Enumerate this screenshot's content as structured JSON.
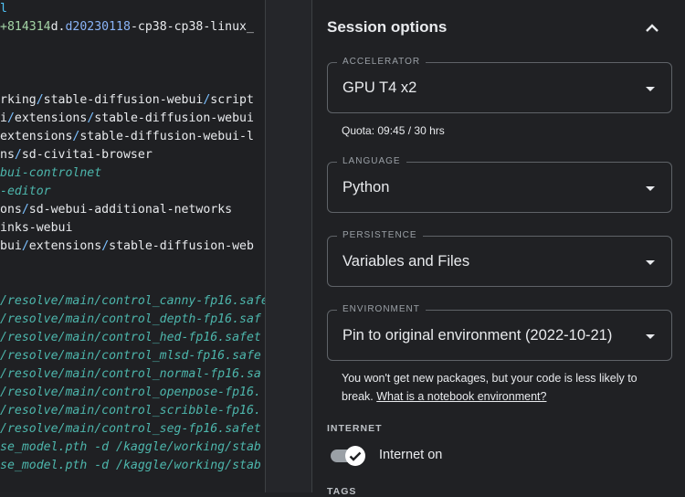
{
  "code_lines": [
    {
      "parts": [
        {
          "t": "l",
          "c": "c-cyan"
        }
      ]
    },
    {
      "parts": [
        {
          "t": "+814314",
          "c": "c-green"
        },
        {
          "t": "d.",
          "c": "c-white"
        },
        {
          "t": "d20230118",
          "c": "c-blue"
        },
        {
          "t": "-cp38-cp38-linux_",
          "c": "c-white"
        }
      ]
    },
    {
      "parts": []
    },
    {
      "parts": []
    },
    {
      "parts": []
    },
    {
      "parts": [
        {
          "t": "rking",
          "c": "c-white"
        },
        {
          "t": "/",
          "c": "c-slash"
        },
        {
          "t": "stable-diffusion-webui",
          "c": "c-white"
        },
        {
          "t": "/",
          "c": "c-slash"
        },
        {
          "t": "script",
          "c": "c-white"
        }
      ]
    },
    {
      "parts": [
        {
          "t": "i",
          "c": "c-white"
        },
        {
          "t": "/",
          "c": "c-slash"
        },
        {
          "t": "extensions",
          "c": "c-white"
        },
        {
          "t": "/",
          "c": "c-slash"
        },
        {
          "t": "stable-diffusion-webui",
          "c": "c-white"
        }
      ]
    },
    {
      "parts": [
        {
          "t": "extensions",
          "c": "c-white"
        },
        {
          "t": "/",
          "c": "c-slash"
        },
        {
          "t": "stable-diffusion-webui-l",
          "c": "c-white"
        }
      ]
    },
    {
      "parts": [
        {
          "t": "ns",
          "c": "c-white"
        },
        {
          "t": "/",
          "c": "c-slash"
        },
        {
          "t": "sd-civitai-browser",
          "c": "c-white"
        }
      ]
    },
    {
      "parts": [
        {
          "t": "bui-controlnet",
          "c": "c-ital"
        }
      ]
    },
    {
      "parts": [
        {
          "t": "-editor",
          "c": "c-ital"
        }
      ]
    },
    {
      "parts": [
        {
          "t": "ons",
          "c": "c-white"
        },
        {
          "t": "/",
          "c": "c-slash"
        },
        {
          "t": "sd-webui-additional-networks",
          "c": "c-white"
        }
      ]
    },
    {
      "parts": [
        {
          "t": "inks-webui",
          "c": "c-white"
        }
      ]
    },
    {
      "parts": [
        {
          "t": "bui",
          "c": "c-white"
        },
        {
          "t": "/",
          "c": "c-slash"
        },
        {
          "t": "extensions",
          "c": "c-white"
        },
        {
          "t": "/",
          "c": "c-slash"
        },
        {
          "t": "stable-diffusion-web",
          "c": "c-white"
        }
      ]
    },
    {
      "parts": []
    },
    {
      "parts": []
    },
    {
      "parts": [
        {
          "t": "/resolve/main/control_canny-fp16.safe",
          "c": "c-ital"
        }
      ]
    },
    {
      "parts": [
        {
          "t": "/resolve/main/control_depth-fp16.saf",
          "c": "c-ital"
        }
      ]
    },
    {
      "parts": [
        {
          "t": "/resolve/main/control_hed-fp16.safet",
          "c": "c-ital"
        }
      ]
    },
    {
      "parts": [
        {
          "t": "/resolve/main/control_mlsd-fp16.safe",
          "c": "c-ital"
        }
      ]
    },
    {
      "parts": [
        {
          "t": "/resolve/main/control_normal-fp16.sa",
          "c": "c-ital"
        }
      ]
    },
    {
      "parts": [
        {
          "t": "/resolve/main/control_openpose-fp16.",
          "c": "c-ital"
        }
      ]
    },
    {
      "parts": [
        {
          "t": "/resolve/main/control_scribble-fp16.",
          "c": "c-ital"
        }
      ]
    },
    {
      "parts": [
        {
          "t": "/resolve/main/control_seg-fp16.safet",
          "c": "c-ital"
        }
      ]
    },
    {
      "parts": [
        {
          "t": "se_model.pth -d /kaggle/working/stab",
          "c": "c-ital"
        }
      ]
    },
    {
      "parts": [
        {
          "t": "se_model.pth -d /kaggle/working/stab",
          "c": "c-ital"
        }
      ]
    }
  ],
  "panel": {
    "title": "Session options",
    "accelerator": {
      "label": "ACCELERATOR",
      "value": "GPU T4 x2",
      "quota": "Quota: 09:45 / 30 hrs"
    },
    "language": {
      "label": "LANGUAGE",
      "value": "Python"
    },
    "persistence": {
      "label": "PERSISTENCE",
      "value": "Variables and Files"
    },
    "environment": {
      "label": "ENVIRONMENT",
      "value": "Pin to original environment (2022-10-21)",
      "note": "You won't get new packages, but your code is less likely to break.",
      "link": "What is a notebook environment?"
    },
    "internet": {
      "section": "INTERNET",
      "toggle_label": "Internet on",
      "on": true
    },
    "next_section": "TAGS"
  },
  "colors": {
    "background": "#202124",
    "border": "#5f6368",
    "text": "#e8eaed",
    "code_italic": "#4db6ac"
  }
}
